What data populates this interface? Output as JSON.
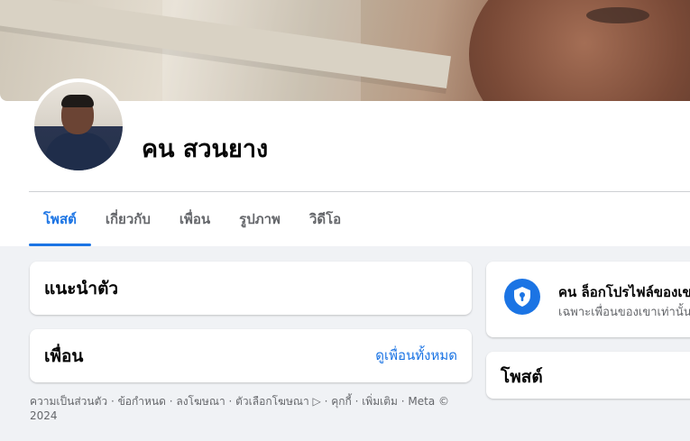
{
  "profile": {
    "name": "คน สวนยาง"
  },
  "tabs": [
    {
      "label": "โพสต์",
      "active": true
    },
    {
      "label": "เกี่ยวกับ",
      "active": false
    },
    {
      "label": "เพื่อน",
      "active": false
    },
    {
      "label": "รูปภาพ",
      "active": false
    },
    {
      "label": "วิดีโอ",
      "active": false
    }
  ],
  "intro_card": {
    "title": "แนะนำตัว"
  },
  "friends_card": {
    "title": "เพื่อน",
    "see_all": "ดูเพื่อนทั้งหมด"
  },
  "footer": {
    "text": "ความเป็นส่วนตัว · ข้อกำหนด · ลงโฆษณา · ตัวเลือกโฆษณา ▷ · คุกกี้ · เพิ่มเติม · Meta © 2024"
  },
  "locked_card": {
    "icon": "shield-lock-icon",
    "title": "คน ล็อกโปรไฟล์ของเขา",
    "subtitle": "เฉพาะเพื่อนของเขาเท่านั้น"
  },
  "posts_card": {
    "title": "โพสต์"
  },
  "colors": {
    "accent": "#1b74e4",
    "background": "#f0f2f5",
    "secondary_text": "#65676b"
  }
}
